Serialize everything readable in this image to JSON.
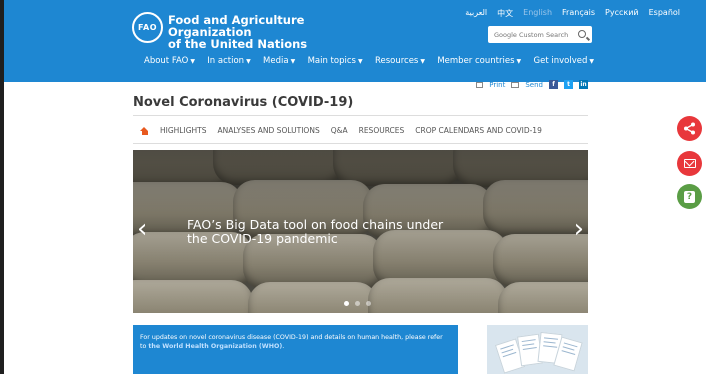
{
  "header": {
    "logo_text": "FAO",
    "org_line1": "Food and Agriculture Organization",
    "org_line2": "of the United Nations",
    "languages": [
      "العربية",
      "中文",
      "English",
      "Français",
      "Русский",
      "Español"
    ],
    "active_language": "English",
    "search_placeholder": "Google Custom Search"
  },
  "nav": {
    "items": [
      {
        "label": "About FAO"
      },
      {
        "label": "In action"
      },
      {
        "label": "Media"
      },
      {
        "label": "Main topics"
      },
      {
        "label": "Resources"
      },
      {
        "label": "Member countries"
      },
      {
        "label": "Get involved"
      }
    ]
  },
  "share": {
    "print": "Print",
    "send": "Send",
    "fb": "f",
    "tw": "t",
    "li": "in"
  },
  "page_title": "Novel Coronavirus (COVID-19)",
  "tabs": [
    "HIGHLIGHTS",
    "ANALYSES AND SOLUTIONS",
    "Q&A",
    "RESOURCES",
    "CROP CALENDARS AND COVID-19"
  ],
  "hero": {
    "caption": "FAO’s Big Data tool on food chains under the COVID-19 pandemic",
    "prev": "‹",
    "next": "›"
  },
  "info_box": {
    "text": "For updates on novel coronavirus disease (COVID-19) and details on human health, please refer to ",
    "link": "the World Health Organization (WHO)",
    "end": "."
  },
  "side_buttons": {
    "help_glyph": "?"
  },
  "colors": {
    "brand_blue": "#1e87d2",
    "accent_orange": "#e8591f",
    "share_red": "#e8373b",
    "help_green": "#5a9d45"
  }
}
